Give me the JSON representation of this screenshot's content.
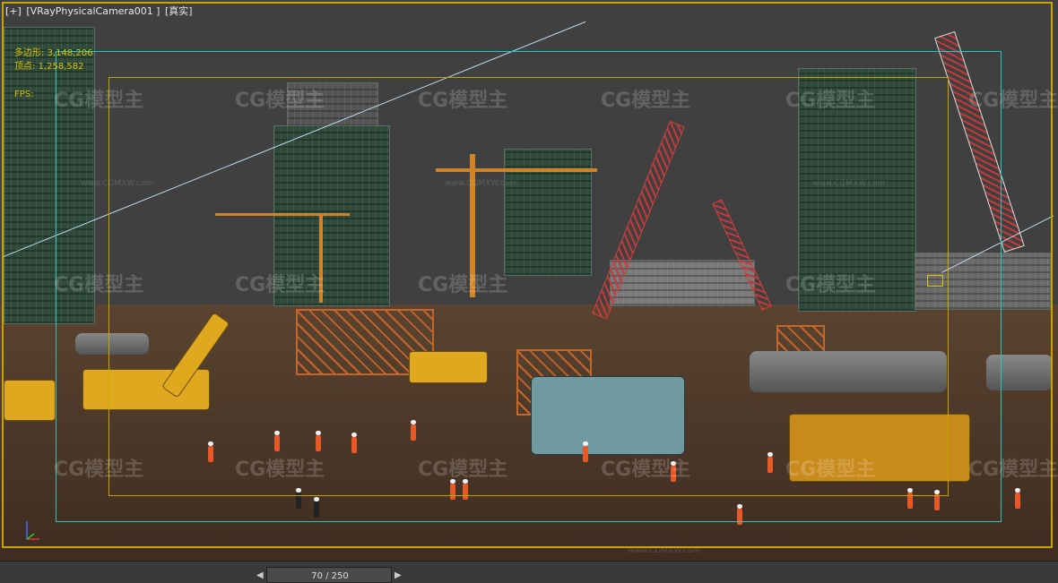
{
  "viewport": {
    "menu_plus": "[+]",
    "camera_name": "[VRayPhysicalCamera001 ]",
    "shading_mode": "[真实]"
  },
  "stats": {
    "polys_label": "多边形:",
    "polys_value": "3,148,206",
    "verts_label": "顶点:",
    "verts_value": "1,258,582",
    "fps_label": "FPS:"
  },
  "watermark": {
    "brand": "CG模型主",
    "url": "www.CGMXW.com"
  },
  "timeline": {
    "frame_text": "70 / 250",
    "prev_icon": "left-arrow-icon",
    "next_icon": "right-arrow-icon"
  },
  "colors": {
    "frame_border": "#c8a400",
    "safe_frame": "#26c6c6",
    "stats_text": "#d8c200"
  }
}
